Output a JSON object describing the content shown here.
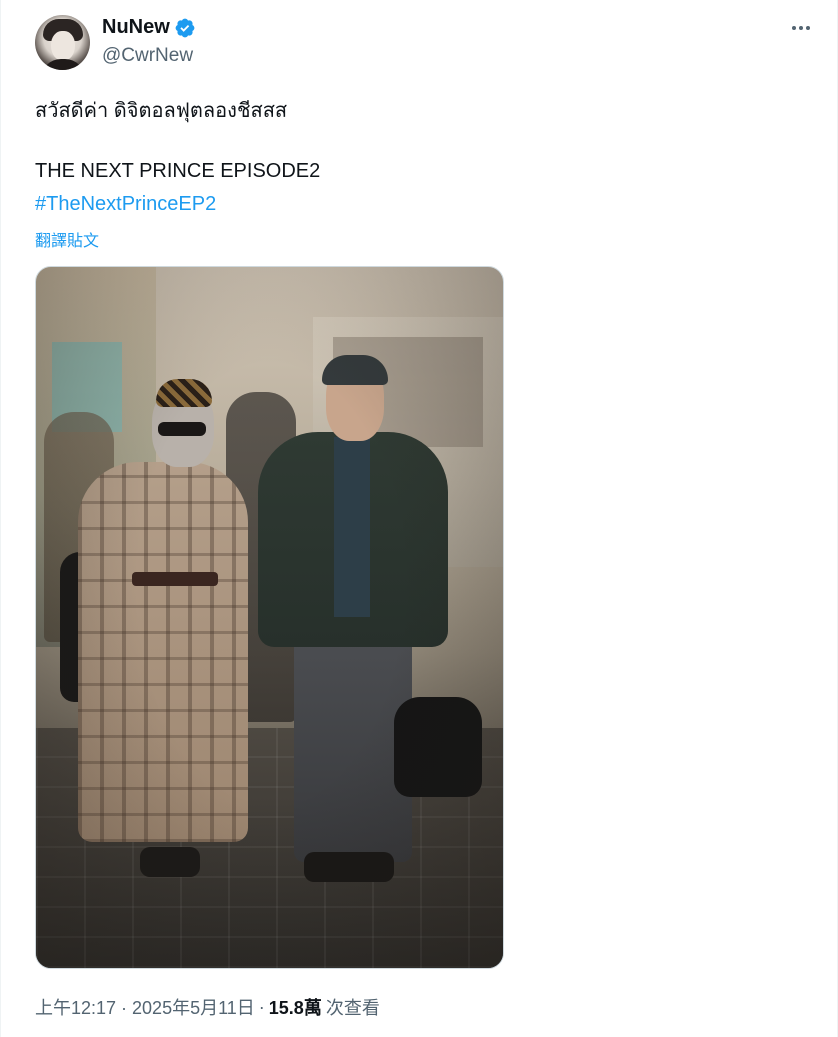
{
  "author": {
    "display_name": "NuNew",
    "handle": "@CwrNew",
    "verified": true,
    "verified_color": "#1d9bf0"
  },
  "tweet": {
    "line1": "สวัสดีค่า ดิจิตอลฟุตลองชีสสส",
    "line2": "THE NEXT PRINCE EPISODE2",
    "hashtag": "#TheNextPrinceEP2",
    "translate_label": "翻譯貼文"
  },
  "meta": {
    "time": "上午12:17 · 2025年5月11日",
    "separator": "·",
    "views_count": "15.8萬",
    "views_label": "次查看"
  },
  "icons": {
    "verified": "verified-badge-icon",
    "more": "more-options-icon"
  },
  "colors": {
    "link": "#1d9bf0",
    "text": "#0f1419",
    "secondary": "#536471"
  }
}
